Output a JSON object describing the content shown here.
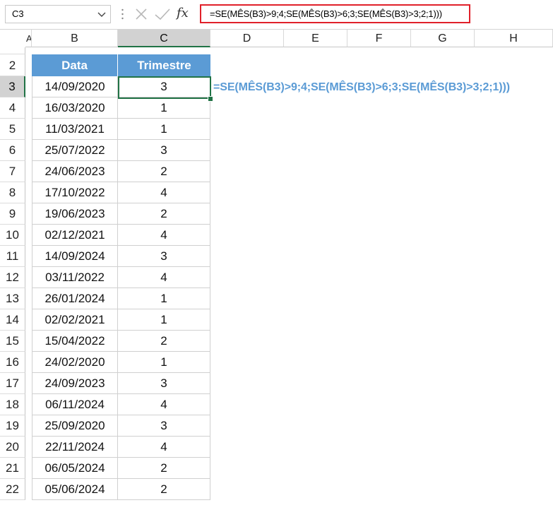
{
  "namebox": {
    "value": "C3"
  },
  "formula_bar": {
    "formula": "=SE(MÊS(B3)>9;4;SE(MÊS(B3)>6;3;SE(MÊS(B3)>3;2;1)))",
    "fx_label": "fx"
  },
  "columns": [
    "A",
    "B",
    "C",
    "D",
    "E",
    "F",
    "G",
    "H"
  ],
  "selected_column": "C",
  "rows": [
    "2",
    "3",
    "4",
    "5",
    "6",
    "7",
    "8",
    "9",
    "10",
    "11",
    "12",
    "13",
    "14",
    "15",
    "16",
    "17",
    "18",
    "19",
    "20",
    "21",
    "22"
  ],
  "selected_row": "3",
  "table": {
    "headers": [
      "Data",
      "Trimestre"
    ],
    "header_color": "#5b9bd5",
    "rows": [
      [
        "14/09/2020",
        "3"
      ],
      [
        "16/03/2020",
        "1"
      ],
      [
        "11/03/2021",
        "1"
      ],
      [
        "25/07/2022",
        "3"
      ],
      [
        "24/06/2023",
        "2"
      ],
      [
        "17/10/2022",
        "4"
      ],
      [
        "19/06/2023",
        "2"
      ],
      [
        "02/12/2021",
        "4"
      ],
      [
        "14/09/2024",
        "3"
      ],
      [
        "03/11/2022",
        "4"
      ],
      [
        "26/01/2024",
        "1"
      ],
      [
        "02/02/2021",
        "1"
      ],
      [
        "15/04/2022",
        "2"
      ],
      [
        "24/02/2020",
        "1"
      ],
      [
        "24/09/2023",
        "3"
      ],
      [
        "06/11/2024",
        "4"
      ],
      [
        "25/09/2020",
        "3"
      ],
      [
        "22/11/2024",
        "4"
      ],
      [
        "06/05/2024",
        "2"
      ],
      [
        "05/06/2024",
        "2"
      ]
    ]
  },
  "annotation": {
    "text": "=SE(MÊS(B3)>9;4;SE(MÊS(B3)>6;3;SE(MÊS(B3)>3;2;1)))",
    "color": "#5b9bd5"
  },
  "colors": {
    "accent_green": "#217346",
    "highlight_red": "#e0202a"
  }
}
